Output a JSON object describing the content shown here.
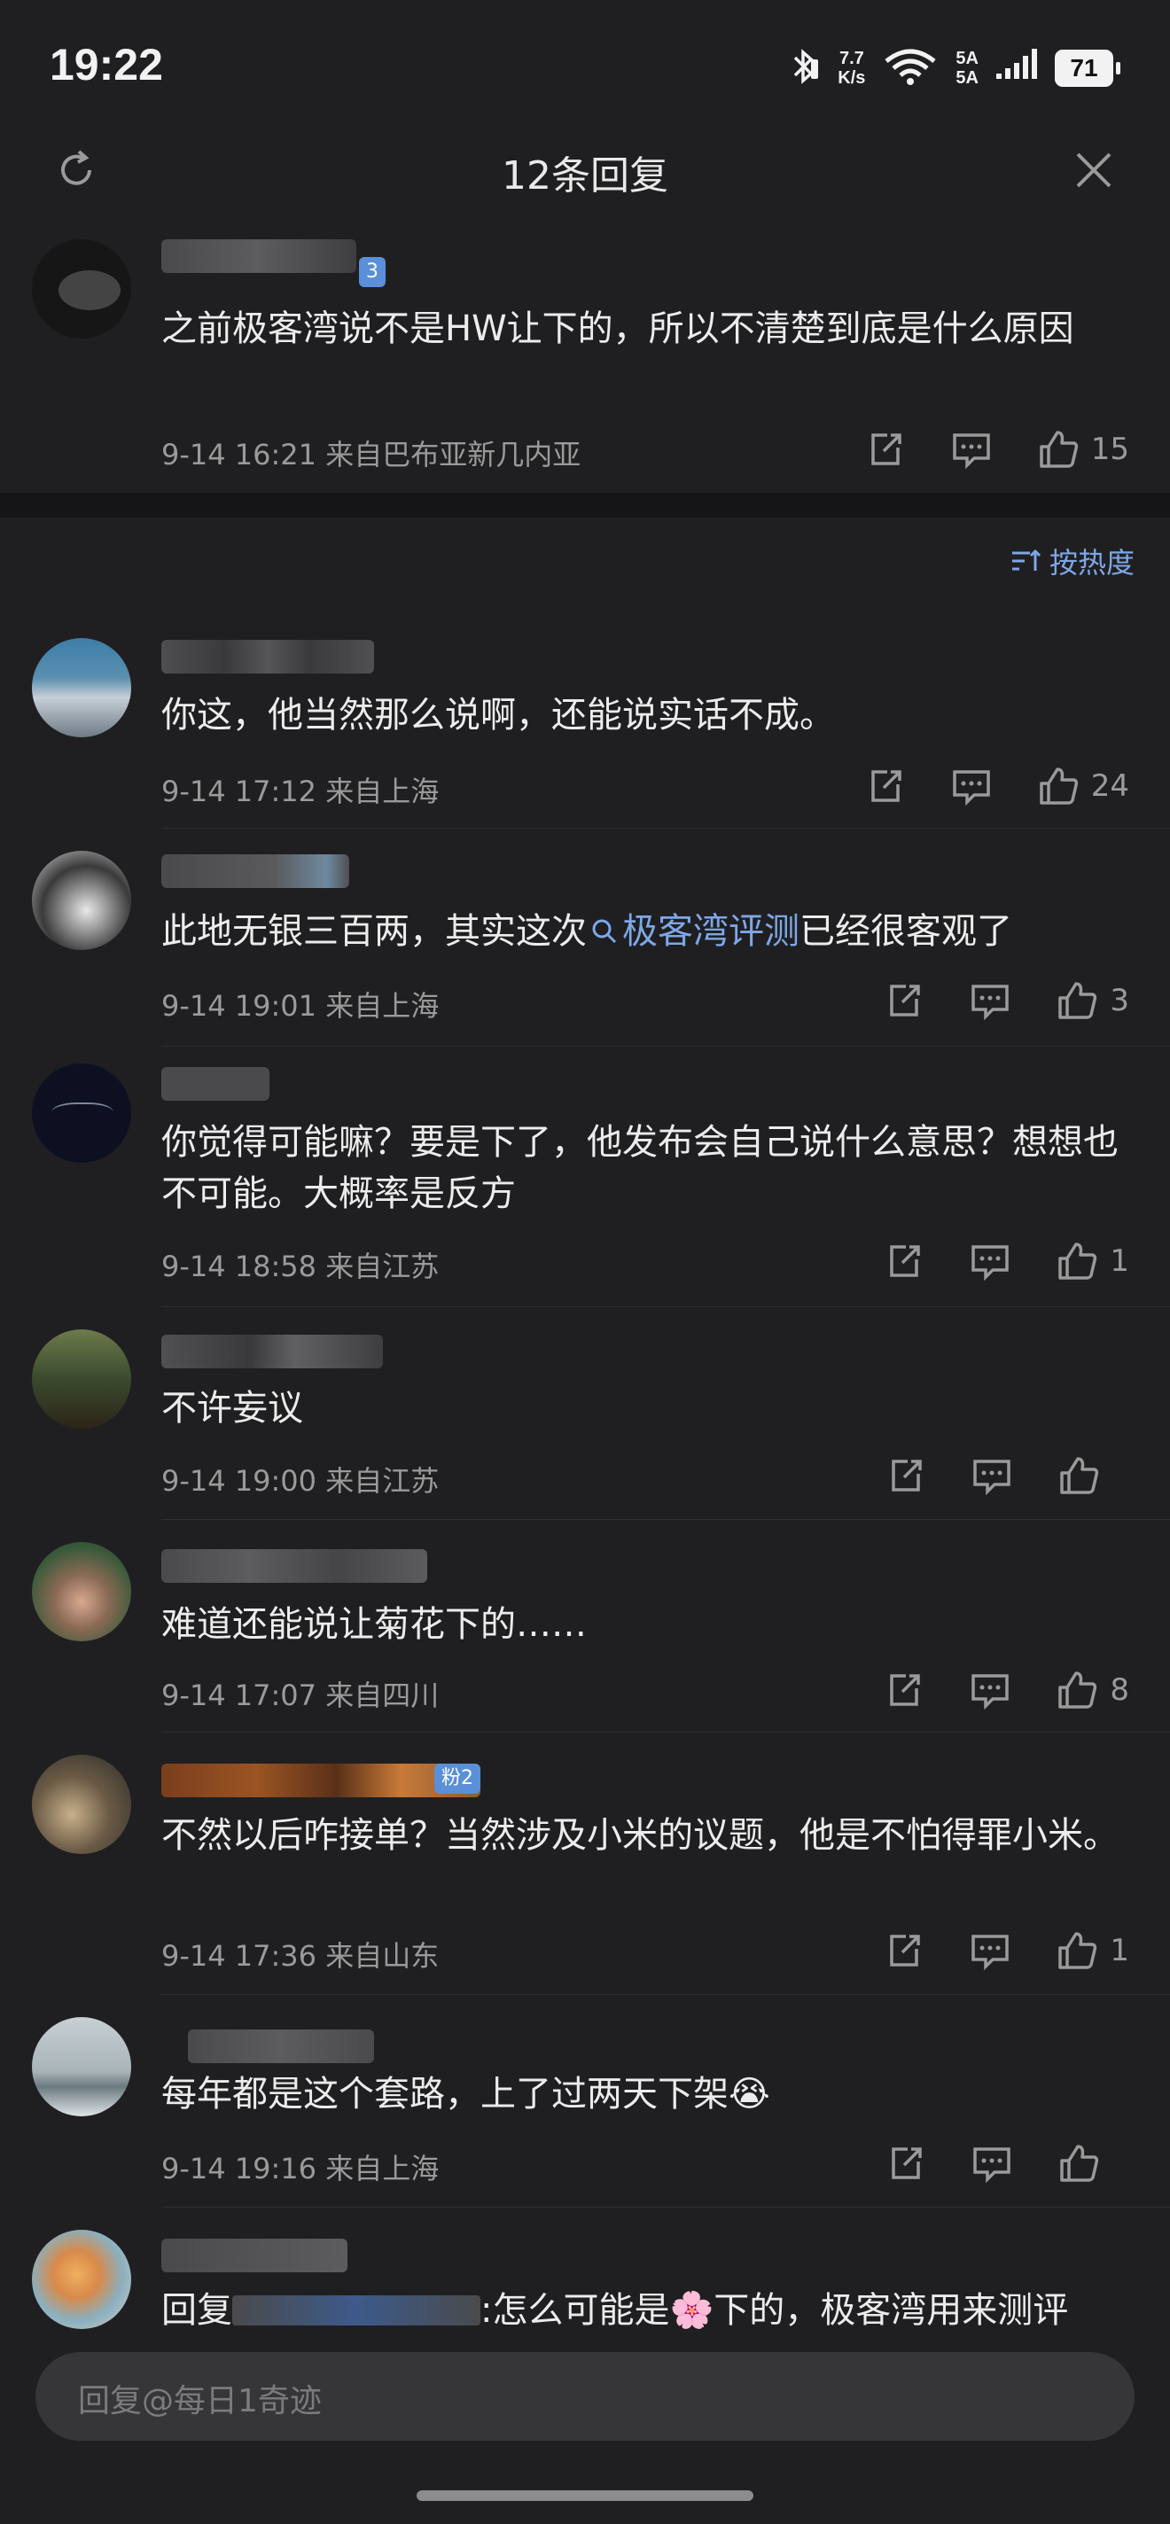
{
  "status_bar": {
    "time": "19:22",
    "net_speed_top": "7.7",
    "net_speed_bottom": "K/s",
    "sim_top": "5A",
    "sim_bottom": "5A",
    "battery": "71"
  },
  "header": {
    "title": "12条回复"
  },
  "main_comment": {
    "badge": "3",
    "text": "之前极客湾说不是HW让下的，所以不清楚到底是什么原因",
    "meta": "9-14 16:21 来自巴布亚新几内亚",
    "likes": "15"
  },
  "sort_label": "按热度",
  "replies": [
    {
      "text": "你这，他当然那么说啊，还能说实话不成。",
      "meta": "9-14 17:12 来自上海",
      "likes": "24"
    },
    {
      "text_before": "此地无银三百两，其实这次",
      "link": "极客湾评测",
      "text_after": "已经很客观了",
      "meta": "9-14 19:01 来自上海",
      "likes": "3"
    },
    {
      "text": "你觉得可能嘛？要是下了，他发布会自己说什么意思？想想也不可能。大概率是反方",
      "meta": "9-14 18:58 来自江苏",
      "likes": "1"
    },
    {
      "text": "不许妄议",
      "meta": "9-14 19:00 来自江苏",
      "likes": ""
    },
    {
      "text": "难道还能说让菊花下的……",
      "meta": "9-14 17:07 来自四川",
      "likes": "8"
    },
    {
      "badge": "粉2",
      "text": "不然以后咋接单？当然涉及小米的议题，他是不怕得罪小米。",
      "meta": "9-14 17:36 来自山东",
      "likes": "1"
    },
    {
      "text": "每年都是这个套路，上了过两天下架😭",
      "meta": "9-14 19:16 来自上海",
      "likes": ""
    },
    {
      "text_prefix": "回复",
      "text": ":怎么可能是🌸下的，极客湾用来测评"
    }
  ],
  "reply_input": {
    "placeholder": "回复@每日1奇迹"
  },
  "colors": {
    "background": "#1f1f21",
    "link": "#7ea7e6",
    "meta": "#9a9a9a"
  }
}
